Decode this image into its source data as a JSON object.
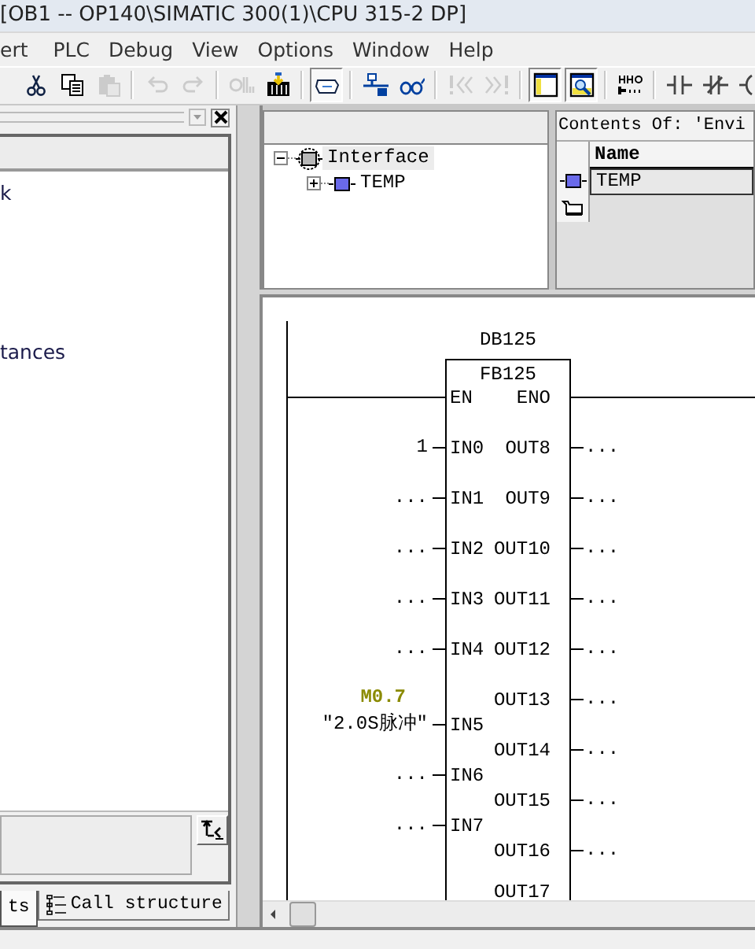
{
  "window": {
    "title": "[OB1 -- OP140\\SIMATIC 300(1)\\CPU 315-2 DP]"
  },
  "menu": [
    "ert",
    "PLC",
    "Debug",
    "View",
    "Options",
    "Window",
    "Help"
  ],
  "toolbar": [
    [
      {
        "kind": "cut",
        "disabled": false,
        "pressed": false
      },
      {
        "kind": "copy",
        "disabled": false,
        "pressed": false
      },
      {
        "kind": "paste",
        "disabled": true,
        "pressed": false
      }
    ],
    [
      {
        "kind": "undo",
        "disabled": true,
        "pressed": false
      },
      {
        "kind": "redo",
        "disabled": true,
        "pressed": false
      }
    ],
    [
      {
        "kind": "compile",
        "disabled": true,
        "pressed": false
      },
      {
        "kind": "download",
        "disabled": false,
        "pressed": false
      }
    ],
    [
      {
        "kind": "monitor",
        "disabled": false,
        "pressed": true
      }
    ],
    [
      {
        "kind": "network",
        "disabled": false,
        "pressed": false
      },
      {
        "kind": "glasses",
        "disabled": false,
        "pressed": false
      }
    ],
    [
      {
        "kind": "preverror",
        "disabled": true,
        "pressed": false
      },
      {
        "kind": "nexterror",
        "disabled": true,
        "pressed": false
      }
    ],
    [
      {
        "kind": "overview",
        "disabled": false,
        "pressed": true
      },
      {
        "kind": "details",
        "disabled": false,
        "pressed": true
      }
    ],
    [
      {
        "kind": "ladderbox",
        "disabled": false,
        "pressed": false
      }
    ],
    [
      {
        "kind": "contact",
        "disabled": false,
        "pressed": false
      },
      {
        "kind": "contactneg",
        "disabled": false,
        "pressed": false
      },
      {
        "kind": "coil",
        "disabled": false,
        "pressed": false
      }
    ]
  ],
  "left_panel": {
    "items": [
      {
        "label": "k"
      },
      {
        "label": "tances"
      }
    ],
    "tabs": [
      {
        "label": "ts",
        "selected": true
      },
      {
        "label": "Call structure",
        "selected": false
      }
    ]
  },
  "interface_tree": [
    {
      "label": "Interface",
      "expanded": true,
      "selected": true,
      "children": [
        {
          "label": "TEMP",
          "expanded": false
        }
      ]
    }
  ],
  "contents": {
    "title": "Contents Of: 'Envi",
    "columns": [
      "Name"
    ],
    "rows": [
      {
        "kind": "variable",
        "name": "TEMP"
      },
      {
        "kind": "new"
      }
    ]
  },
  "network": {
    "instance": "DB125",
    "block": "FB125",
    "enable_in": "EN",
    "enable_out": "ENO",
    "inputs": [
      {
        "pin": "IN0",
        "operand": "1"
      },
      {
        "pin": "IN1",
        "operand": "..."
      },
      {
        "pin": "IN2",
        "operand": "..."
      },
      {
        "pin": "IN3",
        "operand": "..."
      },
      {
        "pin": "IN4",
        "operand": "..."
      },
      {
        "pin": "IN5",
        "address": "M0.7",
        "operand": "\"2.0S脉冲\""
      },
      {
        "pin": "IN6",
        "operand": "..."
      },
      {
        "pin": "IN7",
        "operand": "..."
      }
    ],
    "outputs": [
      {
        "pin": "OUT8",
        "operand": "..."
      },
      {
        "pin": "OUT9",
        "operand": "..."
      },
      {
        "pin": "OUT10",
        "operand": "..."
      },
      {
        "pin": "OUT11",
        "operand": "..."
      },
      {
        "pin": "OUT12",
        "operand": "..."
      },
      {
        "pin": "OUT13",
        "operand": "..."
      },
      {
        "pin": "OUT14",
        "operand": "..."
      },
      {
        "pin": "OUT15",
        "operand": "..."
      },
      {
        "pin": "OUT16",
        "operand": "..."
      },
      {
        "pin": "OUT17"
      }
    ]
  }
}
